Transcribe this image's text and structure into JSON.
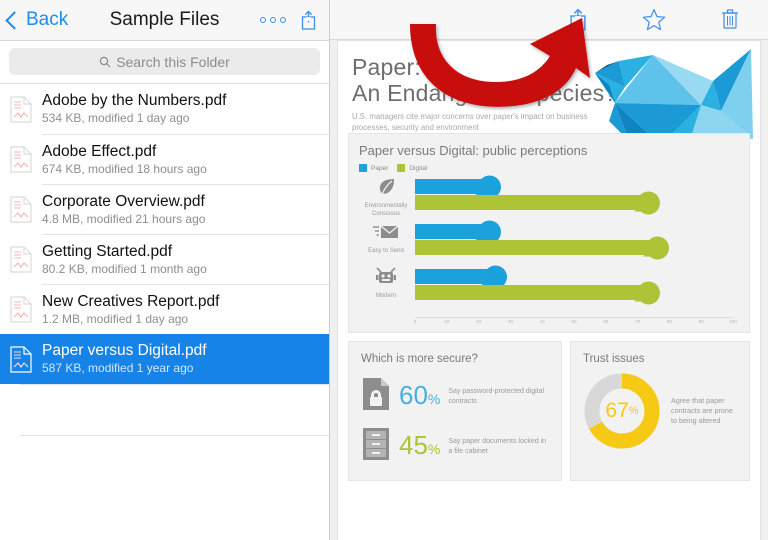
{
  "sidebar": {
    "back_label": "Back",
    "title": "Sample Files",
    "more_icon": "more-dots-icon",
    "share_icon": "share-icon",
    "search": {
      "placeholder": "Search this Folder",
      "icon": "search-icon"
    },
    "files": [
      {
        "name": "Adobe by the Numbers.pdf",
        "meta": "534 KB, modified 1 day ago",
        "icon": "pdf-file-icon",
        "selected": false
      },
      {
        "name": "Adobe Effect.pdf",
        "meta": "674 KB, modified 18 hours ago",
        "icon": "pdf-file-icon",
        "selected": false
      },
      {
        "name": "Corporate Overview.pdf",
        "meta": "4.8 MB, modified 21 hours ago",
        "icon": "pdf-file-icon",
        "selected": false
      },
      {
        "name": "Getting Started.pdf",
        "meta": "80.2 KB, modified 1 month ago",
        "icon": "pdf-file-icon",
        "selected": false
      },
      {
        "name": "New Creatives Report.pdf",
        "meta": "1.2 MB, modified 1 day ago",
        "icon": "pdf-file-icon",
        "selected": false
      },
      {
        "name": "Paper versus Digital.pdf",
        "meta": "587 KB, modified 1 year ago",
        "icon": "pdf-file-icon",
        "selected": true
      }
    ]
  },
  "toolbar": {
    "share_icon": "share-icon",
    "favorite_icon": "star-icon",
    "delete_icon": "trash-icon"
  },
  "annotation": {
    "type": "red-curved-arrow",
    "points_to": "share-icon",
    "color": "#c8100c"
  },
  "document": {
    "title_line1": "Paper:",
    "title_line2": "An Endangered Species?",
    "subtitle": "U.S. managers cite major concerns over paper's impact on business processes, security and environment",
    "hero_icon": "origami-crane-icon"
  },
  "chart_data": {
    "type": "bar",
    "title": "Paper versus Digital: public perceptions",
    "orientation": "horizontal",
    "categories": [
      "Environmentally Conscious",
      "Easy to Send",
      "Modern"
    ],
    "category_icons": [
      "leaf-icon",
      "envelope-icon",
      "robot-icon"
    ],
    "series": [
      {
        "name": "Paper",
        "color": "#1ba1db",
        "values": [
          21,
          21,
          23
        ]
      },
      {
        "name": "Digital",
        "color": "#aec336",
        "values": [
          71,
          74,
          71
        ]
      }
    ],
    "value_suffix": "%",
    "xlabel": "",
    "ylabel": "",
    "xlim": [
      0,
      100
    ],
    "xticks": [
      0,
      10,
      20,
      30,
      40,
      50,
      60,
      70,
      80,
      90,
      100
    ],
    "grid": false,
    "legend_position": "top-left"
  },
  "secure_panel": {
    "title": "Which is more secure?",
    "stats": [
      {
        "value": "60",
        "suffix": "%",
        "color": "#4aaee0",
        "icon": "lock-document-icon",
        "text": "Say password-protected digital contracts"
      },
      {
        "value": "45",
        "suffix": "%",
        "color": "#aec336",
        "icon": "file-cabinet-icon",
        "text": "Say paper documents locked in a file cabinet"
      }
    ]
  },
  "trust_panel": {
    "title": "Trust issues",
    "donut": {
      "value": 67,
      "suffix": "%",
      "color": "#f6c915",
      "track_color": "#d8d8d8"
    },
    "text": "Agree that paper contracts are prone to being altered"
  }
}
